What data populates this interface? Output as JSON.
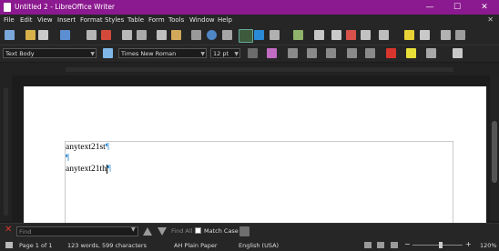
{
  "window": {
    "title": "Untitled 2 - LibreOffice Writer",
    "minimize": "—",
    "maximize": "☐",
    "close": "✕"
  },
  "menu": {
    "items": [
      "File",
      "Edit",
      "View",
      "Insert",
      "Format",
      "Styles",
      "Table",
      "Form",
      "Tools",
      "Window",
      "Help"
    ],
    "close": "✕"
  },
  "format_toolbar": {
    "paragraph_style": "Text Body",
    "font_name": "Times New Roman",
    "font_size": "12 pt"
  },
  "document": {
    "paragraphs": [
      "anytext21st",
      "",
      "anytext21th"
    ],
    "pilcrow": "¶"
  },
  "findbar": {
    "close": "✕",
    "placeholder": "Find",
    "find_all": "Find All",
    "match_case": "Match Case"
  },
  "status": {
    "page": "Page 1 of 1",
    "words": "123 words, 599 characters",
    "page_style": "AH Plain Paper",
    "language": "English (USA)",
    "zoom": "120%",
    "minus": "−",
    "plus": "+"
  },
  "colors": {
    "titlebar": "#8b198f",
    "accent": "#2a8ad6"
  }
}
